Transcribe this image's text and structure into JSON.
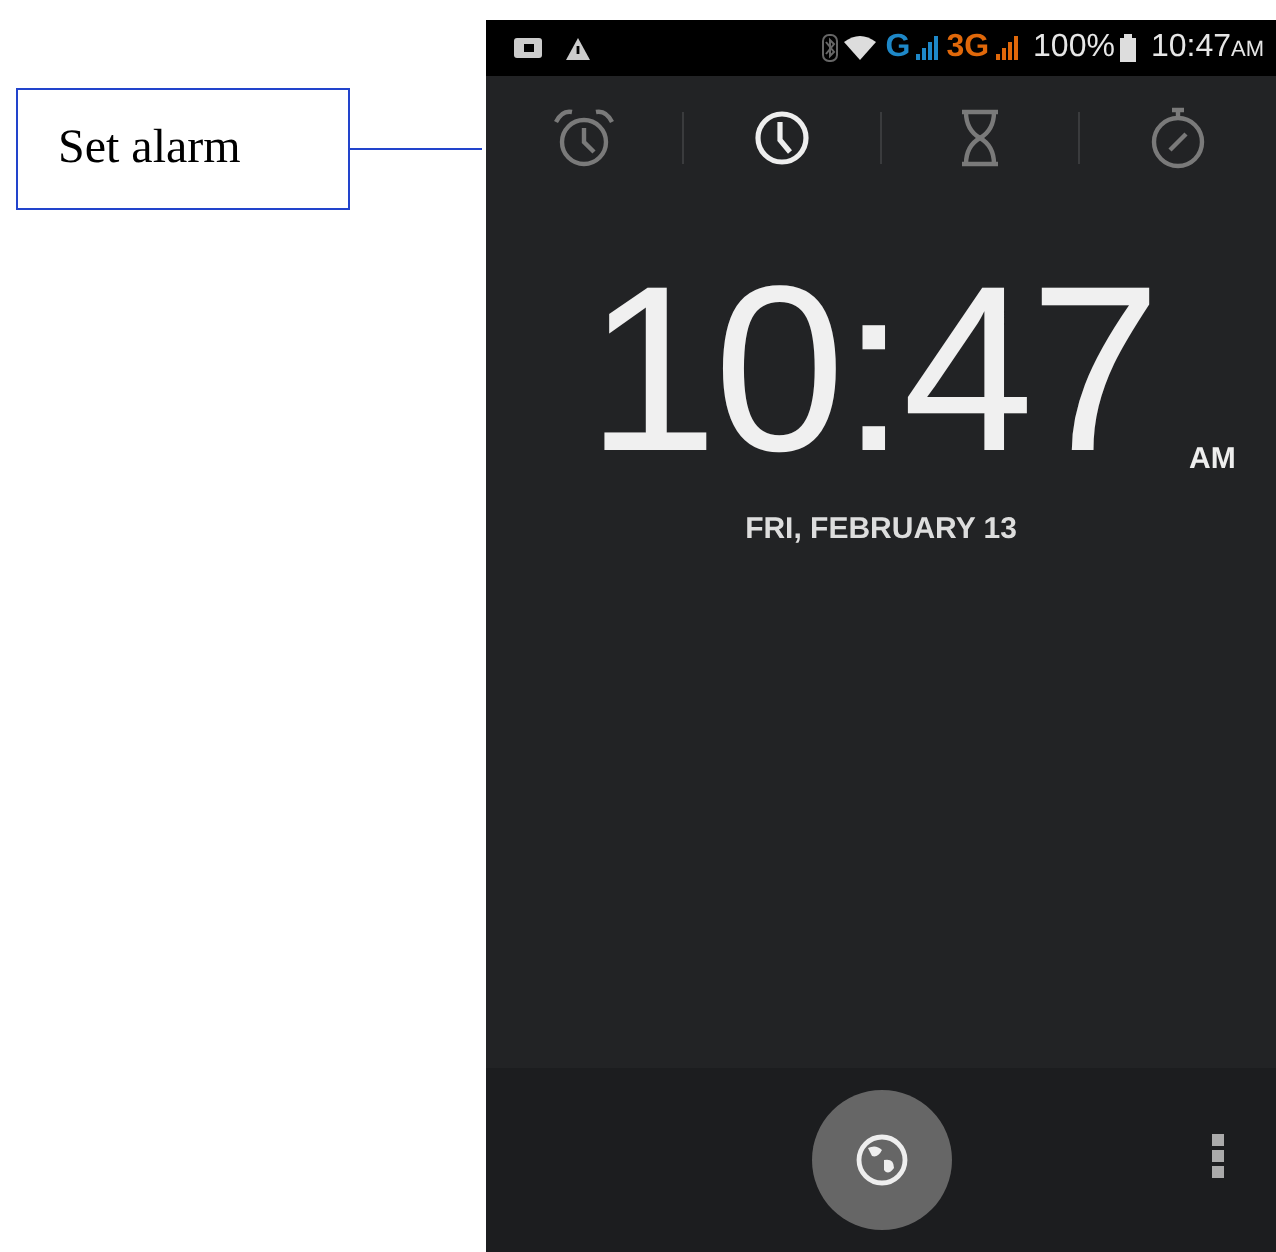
{
  "callout": {
    "label": "Set alarm"
  },
  "status_bar": {
    "network_g": "G",
    "network_3g": "3G",
    "battery": "100%",
    "time": "10:47",
    "ampm": "AM"
  },
  "tabs": [
    {
      "kind": "alarm",
      "selected": false
    },
    {
      "kind": "clock",
      "selected": true
    },
    {
      "kind": "timer",
      "selected": false
    },
    {
      "kind": "stopwatch",
      "selected": false
    }
  ],
  "clock": {
    "time": "10:47",
    "ampm": "AM",
    "date": "FRI, FEBRUARY 13"
  }
}
